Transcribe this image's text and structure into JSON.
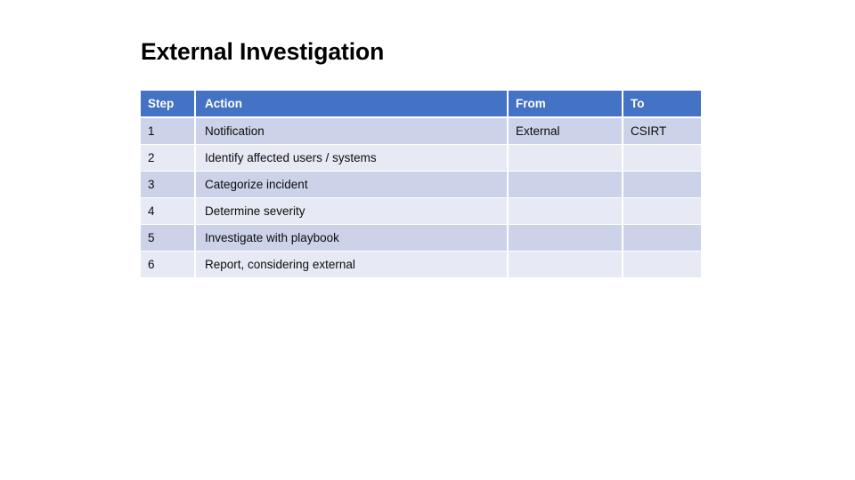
{
  "slide": {
    "title": "External Investigation",
    "background_color": "#ffffff"
  },
  "table": {
    "header_bg": "#4472c4",
    "header_text_color": "#ffffff",
    "row_band_dark": "#ccd2e8",
    "row_band_light": "#e7eaf4",
    "body_text_color": "#0d0d0d",
    "columns": [
      {
        "key": "step",
        "label": "Step"
      },
      {
        "key": "action",
        "label": "Action"
      },
      {
        "key": "from",
        "label": "From"
      },
      {
        "key": "to",
        "label": "To"
      }
    ],
    "rows": [
      {
        "step": "1",
        "action": "Notification",
        "from": "External",
        "to": "CSIRT"
      },
      {
        "step": "2",
        "action": "Identify affected users / systems",
        "from": "",
        "to": ""
      },
      {
        "step": "3",
        "action": "Categorize incident",
        "from": "",
        "to": ""
      },
      {
        "step": "4",
        "action": "Determine severity",
        "from": "",
        "to": ""
      },
      {
        "step": "5",
        "action": "Investigate with playbook",
        "from": "",
        "to": ""
      },
      {
        "step": "6",
        "action": "Report, considering external",
        "from": "",
        "to": ""
      }
    ]
  }
}
